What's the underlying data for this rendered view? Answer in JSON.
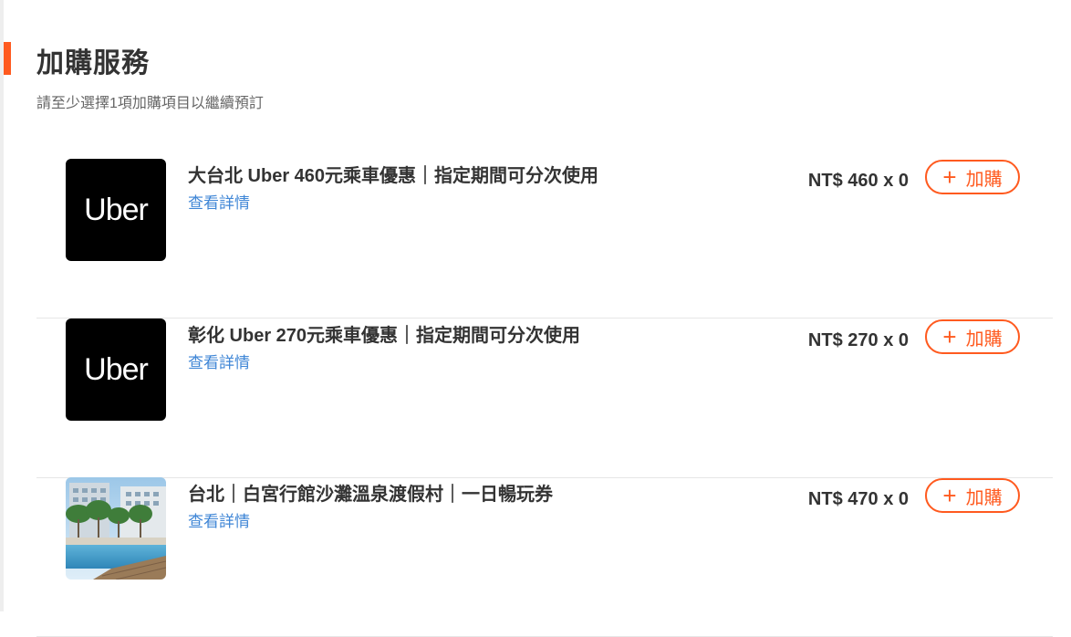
{
  "section": {
    "title": "加購服務",
    "subtitle": "請至少選擇1項加購項目以繼續預訂"
  },
  "items": [
    {
      "thumb_text": "Uber",
      "name": "大台北 Uber 460元乘車優惠｜指定期間可分次使用",
      "detail_label": "查看詳情",
      "price": "NT$ 460 x 0",
      "add_label": "加購"
    },
    {
      "thumb_text": "Uber",
      "name": "彰化 Uber 270元乘車優惠｜指定期間可分次使用",
      "detail_label": "查看詳情",
      "price": "NT$ 270 x 0",
      "add_label": "加購"
    },
    {
      "thumb_text": "",
      "name": "台北｜白宮行館沙灘溫泉渡假村｜一日暢玩券",
      "detail_label": "查看詳情",
      "price": "NT$ 470 x 0",
      "add_label": "加購"
    }
  ],
  "colors": {
    "accent": "#ff5a1f",
    "link": "#3f86d6"
  }
}
